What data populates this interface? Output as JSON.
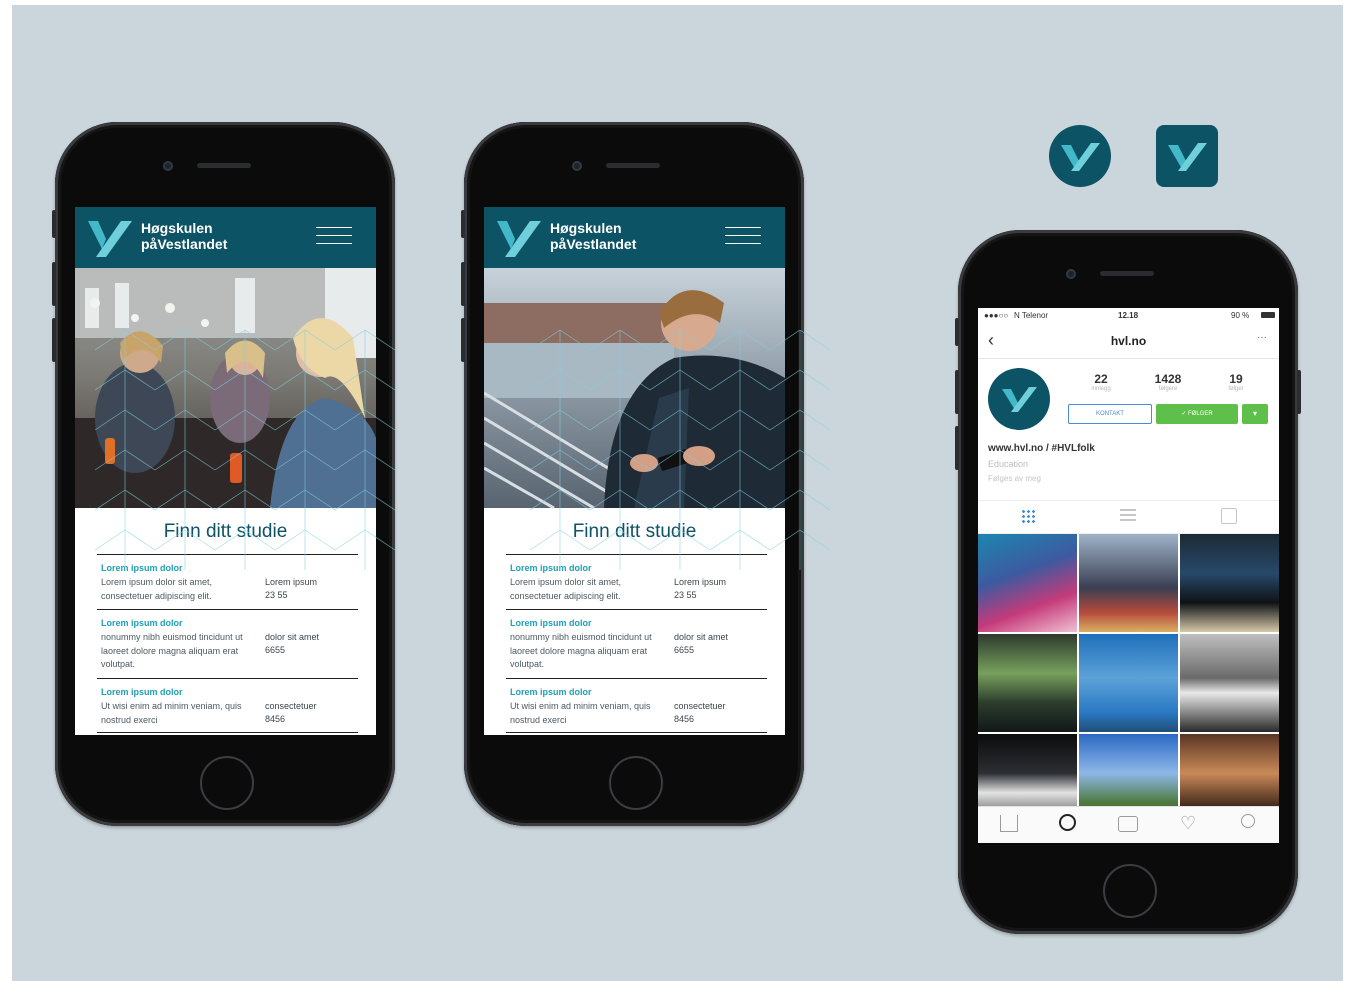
{
  "brand": {
    "name_line1": "Høgskulen",
    "name_line2": "påVestlandet",
    "color": "#0d5366",
    "accent": "#1e9fb5"
  },
  "site": {
    "heading": "Finn ditt studie",
    "items": [
      {
        "title": "Lorem ipsum dolor",
        "text": "Lorem ipsum dolor sit amet, consectetuer adipiscing elit.",
        "side_1": "Lorem ipsum",
        "side_2": "23 55"
      },
      {
        "title": "Lorem ipsum dolor",
        "text": "nonummy nibh euismod tincidunt ut laoreet dolore magna aliquam erat volutpat.",
        "side_1": "dolor sit amet",
        "side_2": "6655"
      },
      {
        "title": "Lorem ipsum dolor",
        "text": "Ut wisi enim ad minim veniam, quis nostrud exerci",
        "side_1": "consectetuer",
        "side_2": "8456"
      }
    ],
    "menu_icon": "hamburger-icon"
  },
  "instagram": {
    "status": {
      "carrier": "N Telenor",
      "time": "12.18",
      "battery": "90 %"
    },
    "username": "hvl.no",
    "stats": [
      {
        "value": "22",
        "label": "innlegg"
      },
      {
        "value": "1428",
        "label": "følgere"
      },
      {
        "value": "19",
        "label": "følger"
      }
    ],
    "contact_label": "KONTAKT",
    "following_label": "✓ FØLGER",
    "bio_link": "www.hvl.no / #HVLfolk",
    "category": "Education",
    "followed_by": "Følges av meg",
    "nav_icons": [
      "home-icon",
      "search-icon",
      "camera-icon",
      "heart-icon",
      "profile-icon"
    ],
    "accent_green": "#5fbf4b"
  }
}
